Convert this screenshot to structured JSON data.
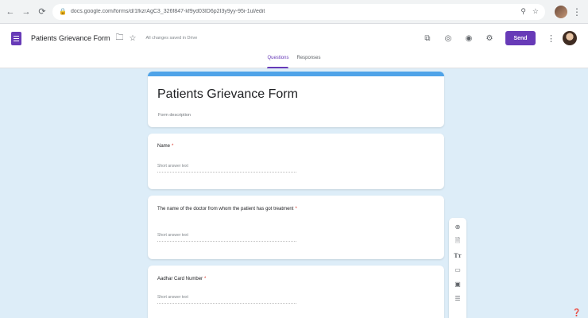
{
  "browser": {
    "url": "docs.google.com/forms/d/1fkzrAgC3_326f847-kf9yd03ID6p2I3y9yy-95i-1ul/edit",
    "icons": [
      "back-icon",
      "forward-icon",
      "reload-icon",
      "lock-icon",
      "zoom-icon",
      "star-icon",
      "profile-icon",
      "menu-icon"
    ]
  },
  "header": {
    "doc_title": "Patients Grievance Form",
    "saved_status": "All changes saved in Drive",
    "send_label": "Send",
    "tabs": [
      {
        "label": "Questions",
        "active": true
      },
      {
        "label": "Responses",
        "active": false
      }
    ]
  },
  "form": {
    "title": "Patients Grievance Form",
    "description": "Form description",
    "questions": [
      {
        "label": "Name",
        "required": "*",
        "placeholder": "Short answer text"
      },
      {
        "label": "The name of the doctor from whom the patient has got treatment",
        "required": "*",
        "placeholder": "Short answer text"
      },
      {
        "label": "Aadhar Card Number",
        "required": "*",
        "placeholder": "Short answer text"
      }
    ]
  },
  "toolbar": {
    "title_glyph": "Tт"
  },
  "colors": {
    "accent": "#673ab7",
    "title_bar": "#4fa3e8",
    "canvas": "#ddedf8"
  }
}
